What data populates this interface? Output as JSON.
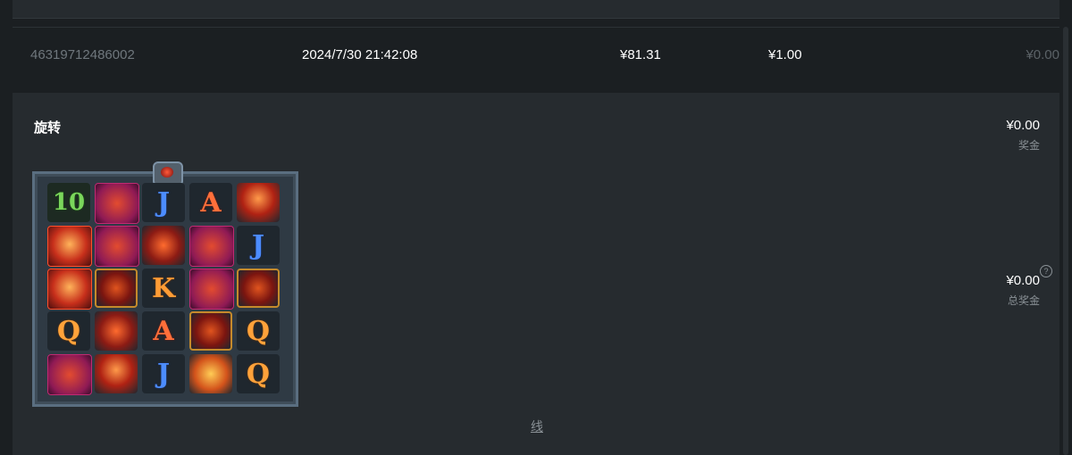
{
  "record": {
    "id": "46319712486002",
    "time": "2024/7/30 21:42:08",
    "bet": "¥81.31",
    "fee": "¥1.00",
    "win": "¥0.00"
  },
  "detail": {
    "title": "旋转",
    "win_amount": "¥0.00",
    "win_label": "奖金",
    "total_amount": "¥0.00",
    "total_label": "总奖金",
    "lines_tab": "线"
  },
  "reels": {
    "symbols": [
      [
        "10",
        "wolf",
        "J",
        "A",
        "cup"
      ],
      [
        "warrior",
        "wolf",
        "eagle",
        "wolf",
        "J"
      ],
      [
        "warrior",
        "shield",
        "K",
        "wolf",
        "shield"
      ],
      [
        "Q",
        "eagle",
        "A",
        "shield",
        "Q"
      ],
      [
        "wolf",
        "cup",
        "J",
        "helmet",
        "Q"
      ]
    ]
  },
  "colors": {
    "background": "#1b1f22",
    "panel": "#262b2f",
    "muted_text": "#8a9196"
  }
}
